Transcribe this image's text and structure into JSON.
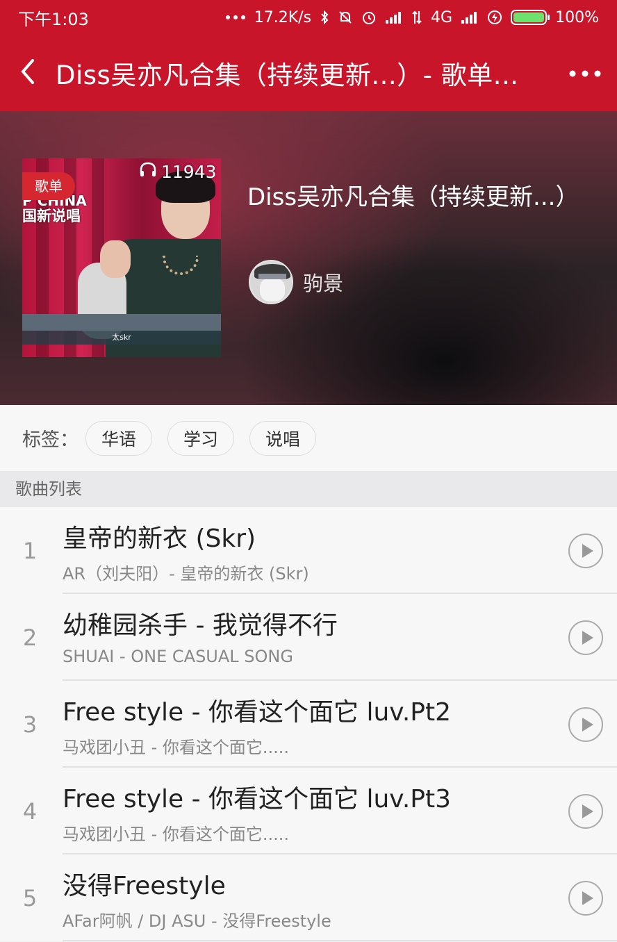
{
  "status_bar": {
    "time": "下午1:03",
    "network_speed": "17.2K/s",
    "network_type": "4G",
    "battery": "100%",
    "icons": [
      "more-dots-icon",
      "bluetooth-icon",
      "mute-bell-icon",
      "alarm-icon",
      "signal-icon",
      "data-arrows-icon",
      "signal-icon",
      "charging-icon",
      "battery-icon"
    ]
  },
  "nav": {
    "title": "Diss吴亦凡合集（持续更新...）- 歌单...",
    "back_icon": "chevron-left-icon",
    "more_icon": "more-dots-icon"
  },
  "header": {
    "badge": "歌单",
    "play_count": "11943",
    "playlist_title": "Diss吴亦凡合集（持续更新...）",
    "creator_name": "驹景",
    "cover_logo_line1": "P CHINA",
    "cover_logo_line2": "国新说唱",
    "cover_caption": "太skr"
  },
  "tags": {
    "label": "标签：",
    "items": [
      "华语",
      "学习",
      "说唱"
    ]
  },
  "list_header": "歌曲列表",
  "songs": [
    {
      "index": "1",
      "title": "皇帝的新衣 (Skr)",
      "subtitle": "AR（刘夫阳）- 皇帝的新衣 (Skr)"
    },
    {
      "index": "2",
      "title": "幼稚园杀手 - 我觉得不行",
      "subtitle": "SHUAI - ONE CASUAL SONG"
    },
    {
      "index": "3",
      "title": "Free style - 你看这个面它 luv.Pt2",
      "subtitle": "马戏团小丑 - 你看这个面它....."
    },
    {
      "index": "4",
      "title": "Free style - 你看这个面它 luv.Pt3",
      "subtitle": "马戏团小丑 - 你看这个面它....."
    },
    {
      "index": "5",
      "title": "没得Freestyle",
      "subtitle": "AFar阿帆 / DJ ASU - 没得Freestyle"
    }
  ],
  "colors": {
    "brand_red": "#c8152a",
    "badge_red": "#d6262f"
  }
}
